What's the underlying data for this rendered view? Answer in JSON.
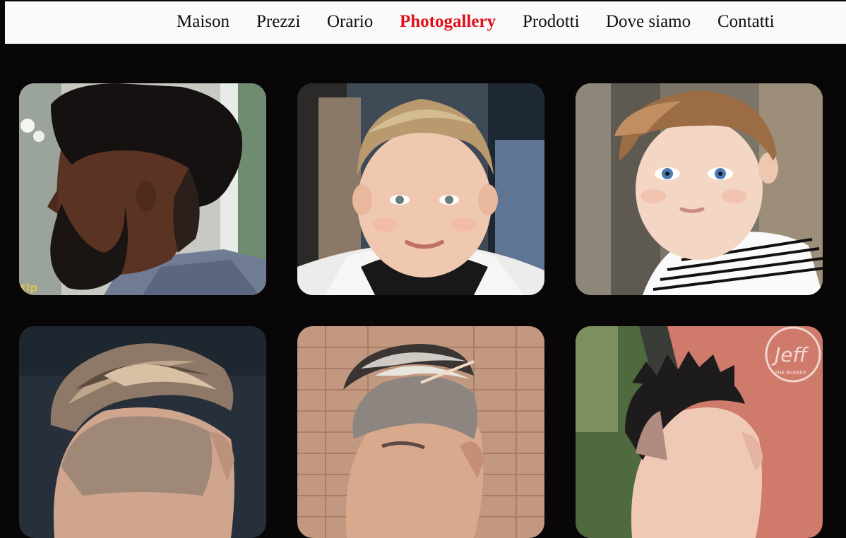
{
  "nav": {
    "items": [
      {
        "label": "Maison",
        "active": false
      },
      {
        "label": "Prezzi",
        "active": false
      },
      {
        "label": "Orario",
        "active": false
      },
      {
        "label": "Photogallery",
        "active": true
      },
      {
        "label": "Prodotti",
        "active": false
      },
      {
        "label": "Dove siamo",
        "active": false
      },
      {
        "label": "Contatti",
        "active": false
      }
    ],
    "active_color": "#e0101a"
  },
  "gallery": {
    "photos": [
      {
        "subject": "man-high-top-fade-beard"
      },
      {
        "subject": "boy-textured-crop"
      },
      {
        "subject": "boy-side-swept-fringe"
      },
      {
        "subject": "man-slicked-back-undercut"
      },
      {
        "subject": "man-hard-part-pompadour"
      },
      {
        "subject": "man-spiky-fade"
      }
    ],
    "watermarks": {
      "photo1": "tip",
      "photo6_script": "Jeff",
      "photo6_ring": "THE BARBER"
    }
  }
}
